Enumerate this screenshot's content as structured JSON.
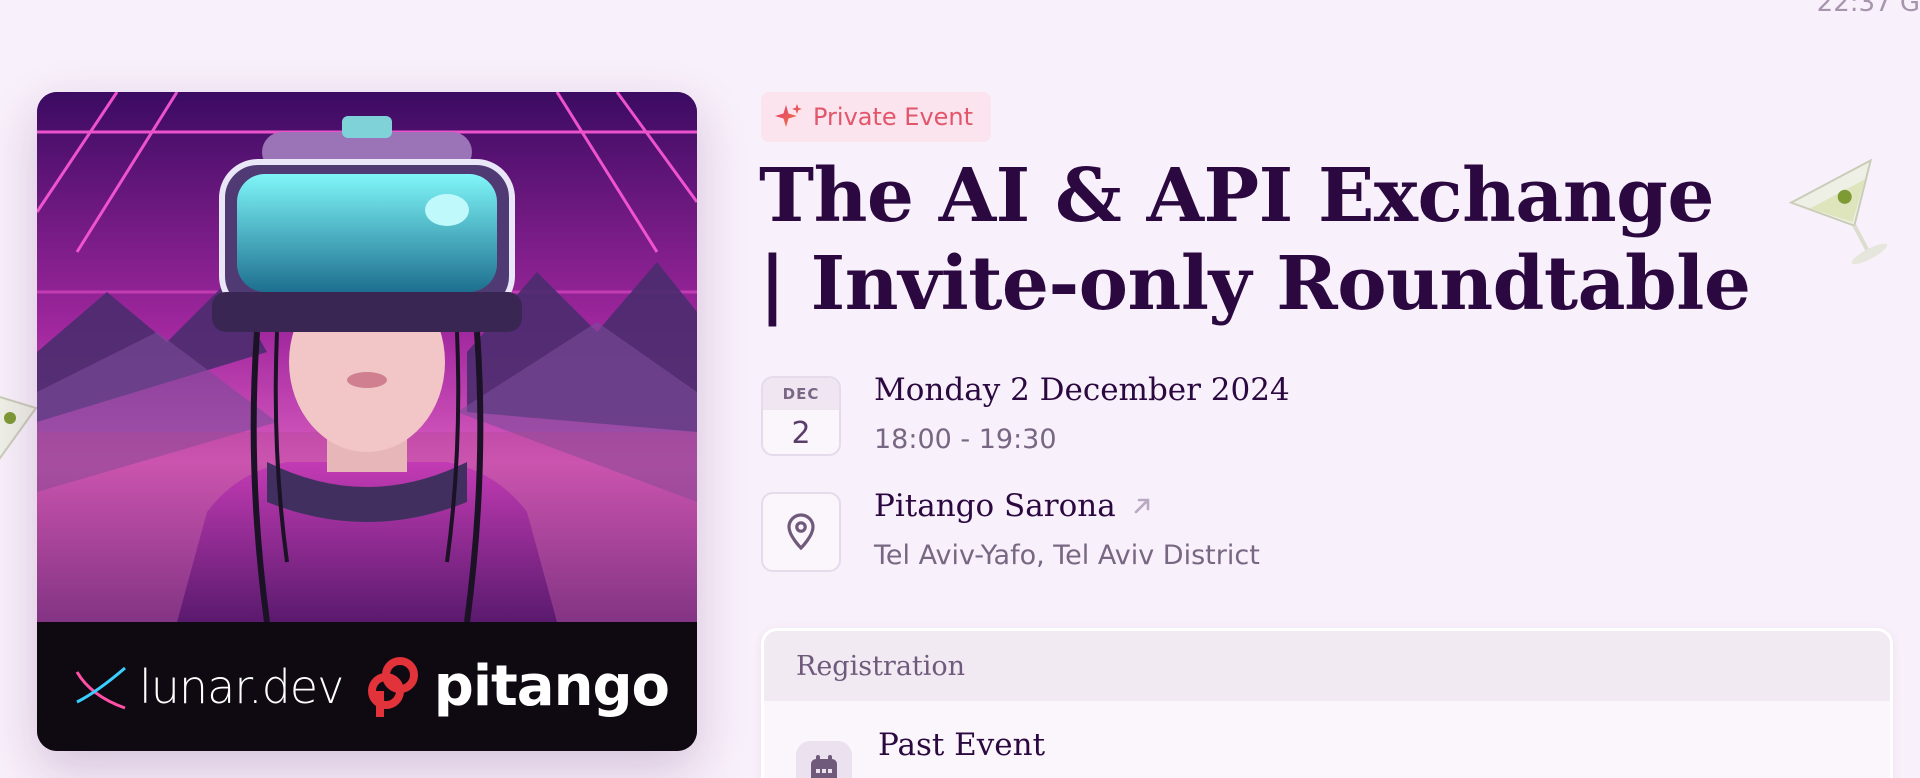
{
  "status_bar": {
    "time": "22:37 G"
  },
  "cover": {
    "logos": {
      "left": "lunar.dev",
      "right": "pitango"
    }
  },
  "event": {
    "badge": {
      "icon": "sparkle-icon",
      "label": "Private Event"
    },
    "title": "The AI & API Exchange | Invite-only Roundtable",
    "date": {
      "month": "DEC",
      "day": "2",
      "full": "Monday 2 December 2024",
      "time": "18:00 - 19:30"
    },
    "location": {
      "name": "Pitango Sarona",
      "area": "Tel Aviv-Yafo, Tel Aviv District",
      "icon": "map-pin-icon"
    }
  },
  "registration": {
    "heading": "Registration",
    "status": "Past Event",
    "icon": "calendar-icon"
  },
  "colors": {
    "background": "#f8f0fa",
    "title": "#2b0940",
    "badge_bg": "#fbe4ee",
    "badge_text": "#e2566b",
    "muted": "#786782"
  }
}
